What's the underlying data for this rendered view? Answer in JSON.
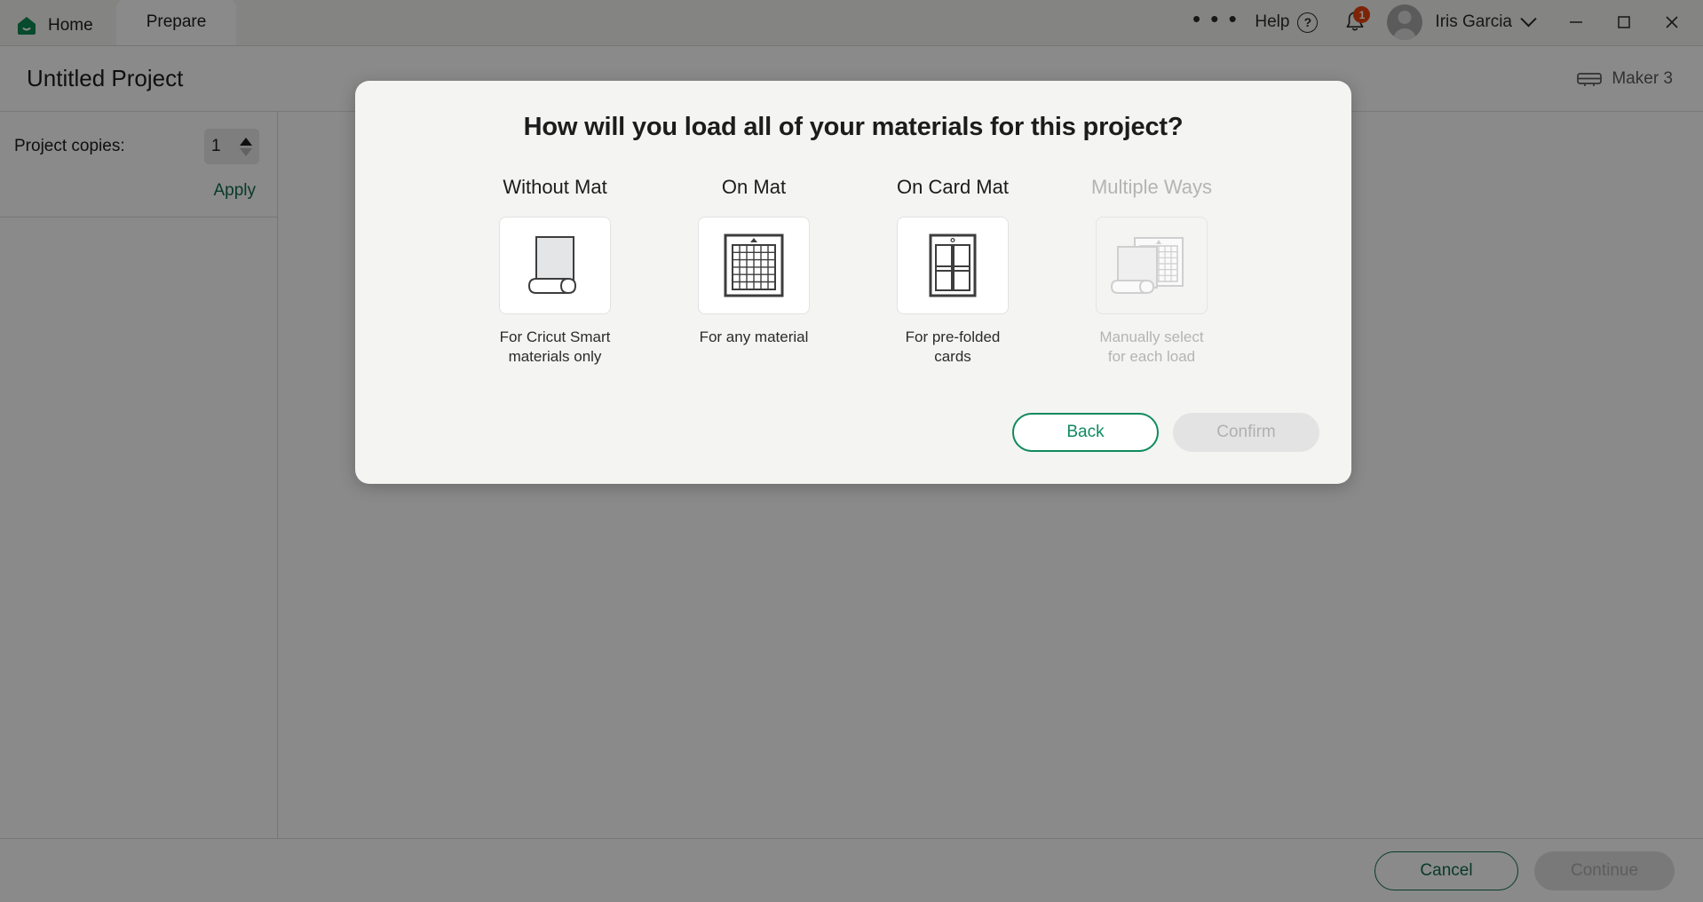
{
  "topbar": {
    "home_tab": "Home",
    "prepare_tab": "Prepare",
    "more_icon": "ellipsis-icon",
    "help_label": "Help",
    "help_icon": "question-circle-icon",
    "notification_icon": "bell-icon",
    "notification_count": "1",
    "avatar_icon": "user-avatar-icon",
    "username": "Iris Garcia",
    "user_chevron_icon": "chevron-down-icon",
    "minimize_icon": "minimize-icon",
    "maximize_icon": "maximize-icon",
    "close_icon": "close-icon"
  },
  "project": {
    "title": "Untitled Project",
    "device_label": "Maker 3",
    "device_icon": "cutting-machine-icon"
  },
  "left_panel": {
    "copies_label": "Project copies:",
    "copies_value": "1",
    "stepper_up_icon": "caret-up-icon",
    "stepper_down_icon": "caret-down-icon",
    "apply_label": "Apply"
  },
  "bottom_bar": {
    "cancel_label": "Cancel",
    "continue_label": "Continue"
  },
  "modal": {
    "title": "How will you load all of your materials for this project?",
    "options": [
      {
        "title": "Without Mat",
        "description": "For Cricut Smart\nmaterials only",
        "icon": "roll-material-icon",
        "disabled": false
      },
      {
        "title": "On Mat",
        "description": "For any material",
        "icon": "cutting-mat-grid-icon",
        "disabled": false
      },
      {
        "title": "On Card Mat",
        "description": "For pre-folded\ncards",
        "icon": "card-mat-icon",
        "disabled": false
      },
      {
        "title": "Multiple Ways",
        "description": "Manually select\nfor each load",
        "icon": "multiple-materials-icon",
        "disabled": true
      }
    ],
    "back_label": "Back",
    "confirm_label": "Confirm"
  },
  "colors": {
    "brand_green": "#0f8a5f",
    "link_green": "#0f6b4f",
    "badge_red": "#e8430f",
    "disabled_gray": "#b4b4b4"
  }
}
